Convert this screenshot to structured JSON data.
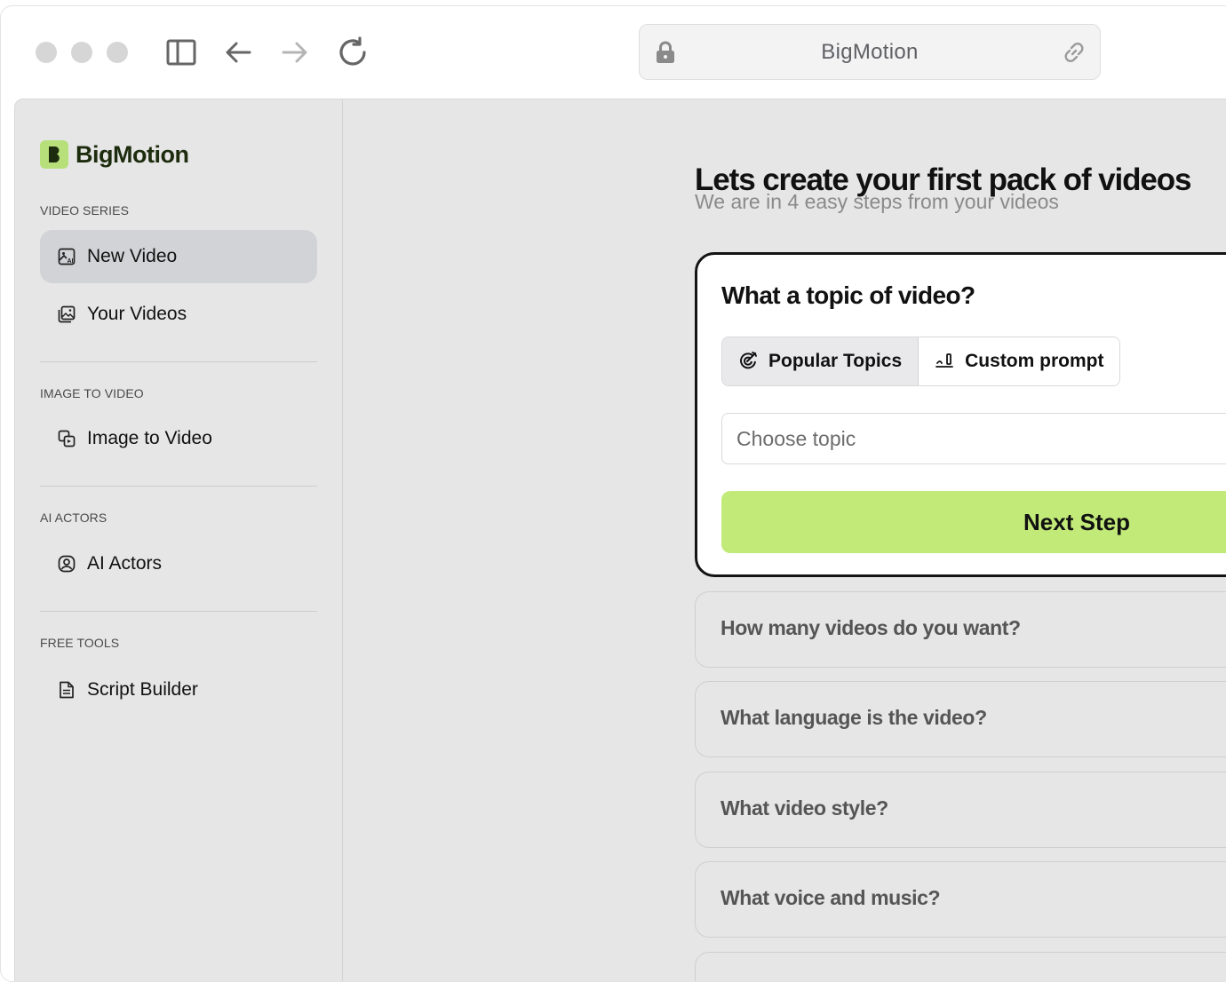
{
  "browser": {
    "address_text": "BigMotion",
    "icons": {
      "lock": "lock-icon",
      "link": "link-icon",
      "sidebar_toggle": "sidebar-toggle-icon",
      "back": "arrow-left-icon",
      "forward": "arrow-right-icon",
      "reload": "reload-icon"
    }
  },
  "sidebar": {
    "brand": "BigMotion",
    "sections": [
      {
        "label": "VIDEO SERIES",
        "items": [
          {
            "label": "New Video",
            "icon": "image-ai-icon",
            "active": true
          },
          {
            "label": "Your Videos",
            "icon": "gallery-icon",
            "active": false
          }
        ]
      },
      {
        "label": "IMAGE TO VIDEO",
        "items": [
          {
            "label": "Image to Video",
            "icon": "image-convert-icon",
            "active": false
          }
        ]
      },
      {
        "label": "AI ACTORS",
        "items": [
          {
            "label": "AI Actors",
            "icon": "user-circle-icon",
            "active": false
          }
        ]
      },
      {
        "label": "FREE TOOLS",
        "items": [
          {
            "label": "Script Builder",
            "icon": "document-icon",
            "active": false
          }
        ]
      }
    ]
  },
  "main": {
    "title": "Lets create your first pack of videos",
    "subtitle": "We are in 4 easy steps from your videos",
    "card": {
      "title": "What a topic of video?",
      "tabs": [
        {
          "label": "Popular Topics",
          "icon": "sparkle-target-icon",
          "active": true
        },
        {
          "label": "Custom prompt",
          "icon": "pen-signature-icon",
          "active": false
        }
      ],
      "input_placeholder": "Choose topic",
      "input_value": "",
      "next_label": "Next Step"
    },
    "steps": [
      "How many videos do you want?",
      "What language is the video?",
      "What video style?",
      "What voice and music?"
    ]
  },
  "colors": {
    "accent": "#c2ea78",
    "brand_logo": "#b8e07a",
    "active_nav": "#d2d3d6",
    "app_bg": "#e6e6e6"
  }
}
